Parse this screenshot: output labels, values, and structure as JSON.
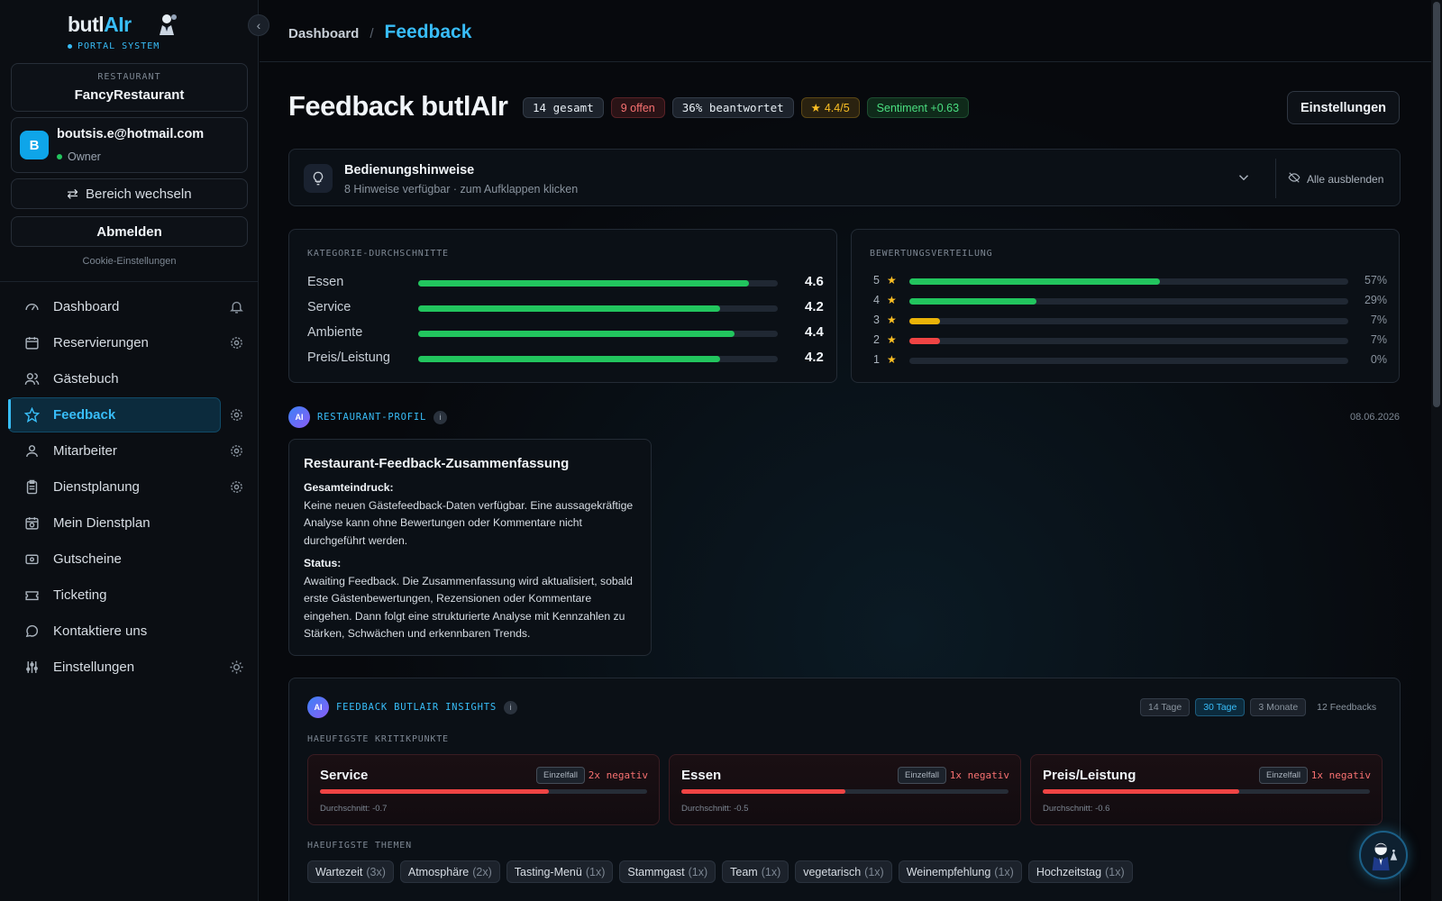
{
  "brand": {
    "name_part1": "butl",
    "name_part2": "AIr",
    "subtitle": "PORTAL SYSTEM"
  },
  "restaurant": {
    "label": "RESTAURANT",
    "name": "FancyRestaurant"
  },
  "user": {
    "initial": "B",
    "email": "boutsis.e@hotmail.com",
    "role": "Owner"
  },
  "sidebar": {
    "switch_label": "Bereich wechseln",
    "logout_label": "Abmelden",
    "cookie_label": "Cookie-Einstellungen",
    "items": [
      {
        "label": "Dashboard",
        "icon": "gauge-icon",
        "right": "bell-icon"
      },
      {
        "label": "Reservierungen",
        "icon": "calendar-icon",
        "right": "gear-icon"
      },
      {
        "label": "Gästebuch",
        "icon": "users-icon",
        "right": ""
      },
      {
        "label": "Feedback",
        "icon": "star-icon",
        "right": "gear-icon",
        "active": true
      },
      {
        "label": "Mitarbeiter",
        "icon": "user-icon",
        "right": "gear-icon"
      },
      {
        "label": "Dienstplanung",
        "icon": "clipboard-icon",
        "right": "gear-icon"
      },
      {
        "label": "Mein Dienstplan",
        "icon": "calendar-clock-icon",
        "right": ""
      },
      {
        "label": "Gutscheine",
        "icon": "wallet-icon",
        "right": ""
      },
      {
        "label": "Ticketing",
        "icon": "ticket-icon",
        "right": ""
      },
      {
        "label": "Kontaktiere uns",
        "icon": "chat-icon",
        "right": ""
      },
      {
        "label": "Einstellungen",
        "icon": "sliders-icon",
        "right": "sun-icon"
      }
    ]
  },
  "breadcrumb": {
    "parent": "Dashboard",
    "separator": "/",
    "current": "Feedback"
  },
  "header": {
    "title": "Feedback butlAIr",
    "badges": {
      "total": "14 gesamt",
      "open": "9 offen",
      "answered": "36% beantwortet",
      "rating": "4.4/5",
      "sentiment": "Sentiment +0.63"
    },
    "settings_label": "Einstellungen"
  },
  "hints": {
    "title": "Bedienungshinweise",
    "subtitle": "8 Hinweise verfügbar · zum Aufklappen klicken",
    "hide_label": "Alle ausblenden"
  },
  "categories": {
    "label": "KATEGORIE-DURCHSCHNITTE",
    "rows": [
      {
        "name": "Essen",
        "value": "4.6",
        "fill": 0.92
      },
      {
        "name": "Service",
        "value": "4.2",
        "fill": 0.84
      },
      {
        "name": "Ambiente",
        "value": "4.4",
        "fill": 0.88
      },
      {
        "name": "Preis/Leistung",
        "value": "4.2",
        "fill": 0.84
      }
    ]
  },
  "distribution": {
    "label": "BEWERTUNGSVERTEILUNG",
    "rows": [
      {
        "stars": "5",
        "percent": "57%",
        "fill": 0.57,
        "color": "#22c55e"
      },
      {
        "stars": "4",
        "percent": "29%",
        "fill": 0.29,
        "color": "#22c55e"
      },
      {
        "stars": "3",
        "percent": "7%",
        "fill": 0.07,
        "color": "#eab308"
      },
      {
        "stars": "2",
        "percent": "7%",
        "fill": 0.07,
        "color": "#ef4444"
      },
      {
        "stars": "1",
        "percent": "0%",
        "fill": 0.0,
        "color": "#ef4444"
      }
    ]
  },
  "profile": {
    "ai_badge": "AI",
    "label": "RESTAURANT-PROFIL",
    "info": "i",
    "date": "08.06.2026",
    "summary_title": "Restaurant-Feedback-Zusammenfassung",
    "impression_heading": "Gesamteindruck:",
    "impression_text": "Keine neuen Gästefeedback-Daten verfügbar. Eine aussagekräftige Analyse kann ohne Bewertungen oder Kommentare nicht durchgeführt werden.",
    "status_heading": "Status:",
    "status_text": "Awaiting Feedback. Die Zusammenfassung wird aktualisiert, sobald erste Gästenbewertungen, Rezensionen oder Kommentare eingehen. Dann folgt eine strukturierte Analyse mit Kennzahlen zu Stärken, Schwächen und erkennbaren Trends."
  },
  "insights": {
    "ai_badge": "AI",
    "label": "FEEDBACK BUTLAIR INSIGHTS",
    "info": "i",
    "ranges": [
      "14 Tage",
      "30 Tage",
      "3 Monate"
    ],
    "active_range": "30 Tage",
    "count": "12 Feedbacks",
    "critique_label": "HAEUFIGSTE KRITIKPUNKTE",
    "critiques": [
      {
        "name": "Service",
        "tag": "Einzelfall",
        "negative": "2x negativ",
        "fill": 0.7,
        "average": "Durchschnitt: -0.7"
      },
      {
        "name": "Essen",
        "tag": "Einzelfall",
        "negative": "1x negativ",
        "fill": 0.5,
        "average": "Durchschnitt: -0.5"
      },
      {
        "name": "Preis/Leistung",
        "tag": "Einzelfall",
        "negative": "1x negativ",
        "fill": 0.6,
        "average": "Durchschnitt: -0.6"
      }
    ],
    "themes_label": "HAEUFIGSTE THEMEN",
    "themes": [
      {
        "name": "Wartezeit",
        "count": "(3x)"
      },
      {
        "name": "Atmosphäre",
        "count": "(2x)"
      },
      {
        "name": "Tasting-Menü",
        "count": "(1x)"
      },
      {
        "name": "Stammgast",
        "count": "(1x)"
      },
      {
        "name": "Team",
        "count": "(1x)"
      },
      {
        "name": "vegetarisch",
        "count": "(1x)"
      },
      {
        "name": "Weinempfehlung",
        "count": "(1x)"
      },
      {
        "name": "Hochzeitstag",
        "count": "(1x)"
      }
    ]
  }
}
